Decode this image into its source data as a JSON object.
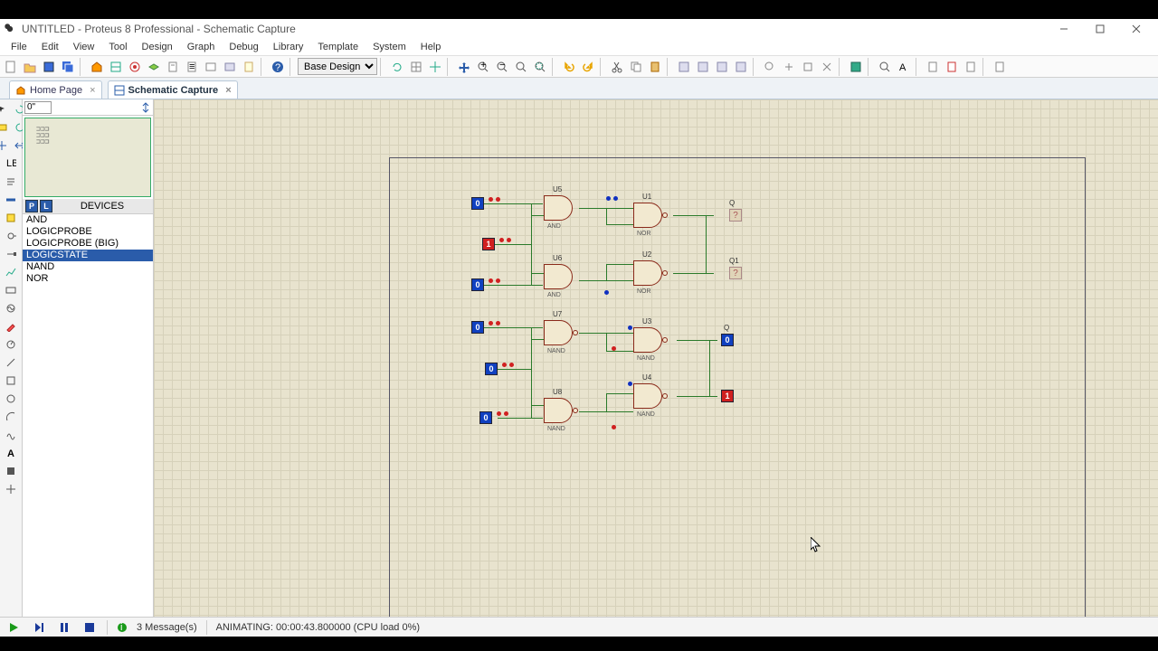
{
  "window": {
    "title": "UNTITLED - Proteus 8 Professional - Schematic Capture"
  },
  "menu": [
    "File",
    "Edit",
    "View",
    "Tool",
    "Design",
    "Graph",
    "Debug",
    "Library",
    "Template",
    "System",
    "Help"
  ],
  "design_selector": "Base Design",
  "tabs": [
    {
      "label": "Home Page",
      "active": false
    },
    {
      "label": "Schematic Capture",
      "active": true
    }
  ],
  "left": {
    "coord_input": "0\"",
    "devices_header": "DEVICES",
    "devices": [
      "AND",
      "LOGICPROBE",
      "LOGICPROBE (BIG)",
      "LOGICSTATE",
      "NAND",
      "NOR"
    ],
    "selected_device": "LOGICSTATE"
  },
  "schematic": {
    "gates": [
      {
        "ref": "U5",
        "type": "AND",
        "neg": false
      },
      {
        "ref": "U6",
        "type": "AND",
        "neg": false
      },
      {
        "ref": "U1",
        "type": "NOR",
        "neg": true
      },
      {
        "ref": "U2",
        "type": "NOR",
        "neg": true
      },
      {
        "ref": "U7",
        "type": "NAND",
        "neg": true
      },
      {
        "ref": "U8",
        "type": "NAND",
        "neg": true
      },
      {
        "ref": "U3",
        "type": "NAND",
        "neg": true
      },
      {
        "ref": "U4",
        "type": "NAND",
        "neg": true
      }
    ],
    "inputs": [
      {
        "value": "0",
        "color": "blue"
      },
      {
        "value": "1",
        "color": "red"
      },
      {
        "value": "0",
        "color": "blue"
      },
      {
        "value": "0",
        "color": "blue"
      },
      {
        "value": "0",
        "color": "blue"
      },
      {
        "value": "0",
        "color": "blue"
      }
    ],
    "outputs": [
      {
        "label": "Q",
        "value": "?",
        "class": "logicout"
      },
      {
        "label": "Q1",
        "value": "?",
        "class": "logicout"
      },
      {
        "label": "Q",
        "value": "0",
        "class": "logicstate"
      },
      {
        "label": "",
        "value": "1",
        "class": "logicstate red"
      }
    ]
  },
  "status": {
    "messages": "3 Message(s)",
    "animating": "ANIMATING: 00:00:43.800000 (CPU load 0%)"
  }
}
